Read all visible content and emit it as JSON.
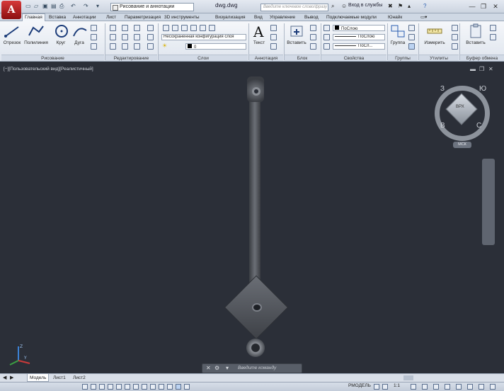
{
  "titlebar": {
    "app_letter": "A",
    "workspace": "Рисование и аннотации",
    "document": "dwg.dwg",
    "search_placeholder": "Введите ключевое слово/фразу",
    "signin": "Вход в службы",
    "minimize": "—",
    "maximize": "❐",
    "close": "✕"
  },
  "tabs": [
    "Главная",
    "Вставка",
    "Аннотации",
    "Лист",
    "Параметризация",
    "3D инструменты",
    "Визуализация",
    "Вид",
    "Управление",
    "Вывод",
    "Подключаемые модули",
    "Юнайк"
  ],
  "ribbon": {
    "draw": {
      "line": "Отрезок",
      "polyline": "Полилиния",
      "circle": "Круг",
      "arc": "Дуга",
      "title": "Рисование"
    },
    "modify": {
      "title": "Редактирование"
    },
    "layers": {
      "layer_state": "Несохраненная конфигурация слоя",
      "layer_current": "0",
      "title": "Слои"
    },
    "annotation": {
      "text": "Текст",
      "title": "Аннотация"
    },
    "block": {
      "insert": "Вставить",
      "title": "Блок"
    },
    "properties": {
      "color": "ПоСлою",
      "linetype": "ПоСлою",
      "lineweight": "ПоСл...",
      "title": "Свойства"
    },
    "groups": {
      "group": "Группа",
      "title": "Группы"
    },
    "utilities": {
      "measure": "Измерить",
      "title": "Утилиты"
    },
    "clipboard": {
      "paste": "Вставить",
      "title": "Буфер обмена"
    }
  },
  "viewport": {
    "label": "[−][Пользовательский вид][Реалистичный]",
    "viewcube_face": "ВРХ",
    "compass": {
      "n": "З",
      "e": "Ю",
      "s": "С",
      "w": "В"
    },
    "wcs": "МСК"
  },
  "command": {
    "placeholder": "Введите команду"
  },
  "layouts": [
    "Модель",
    "Лист1",
    "Лист2"
  ],
  "status": {
    "model": "РМОДЕЛЬ",
    "scale": "1:1"
  }
}
